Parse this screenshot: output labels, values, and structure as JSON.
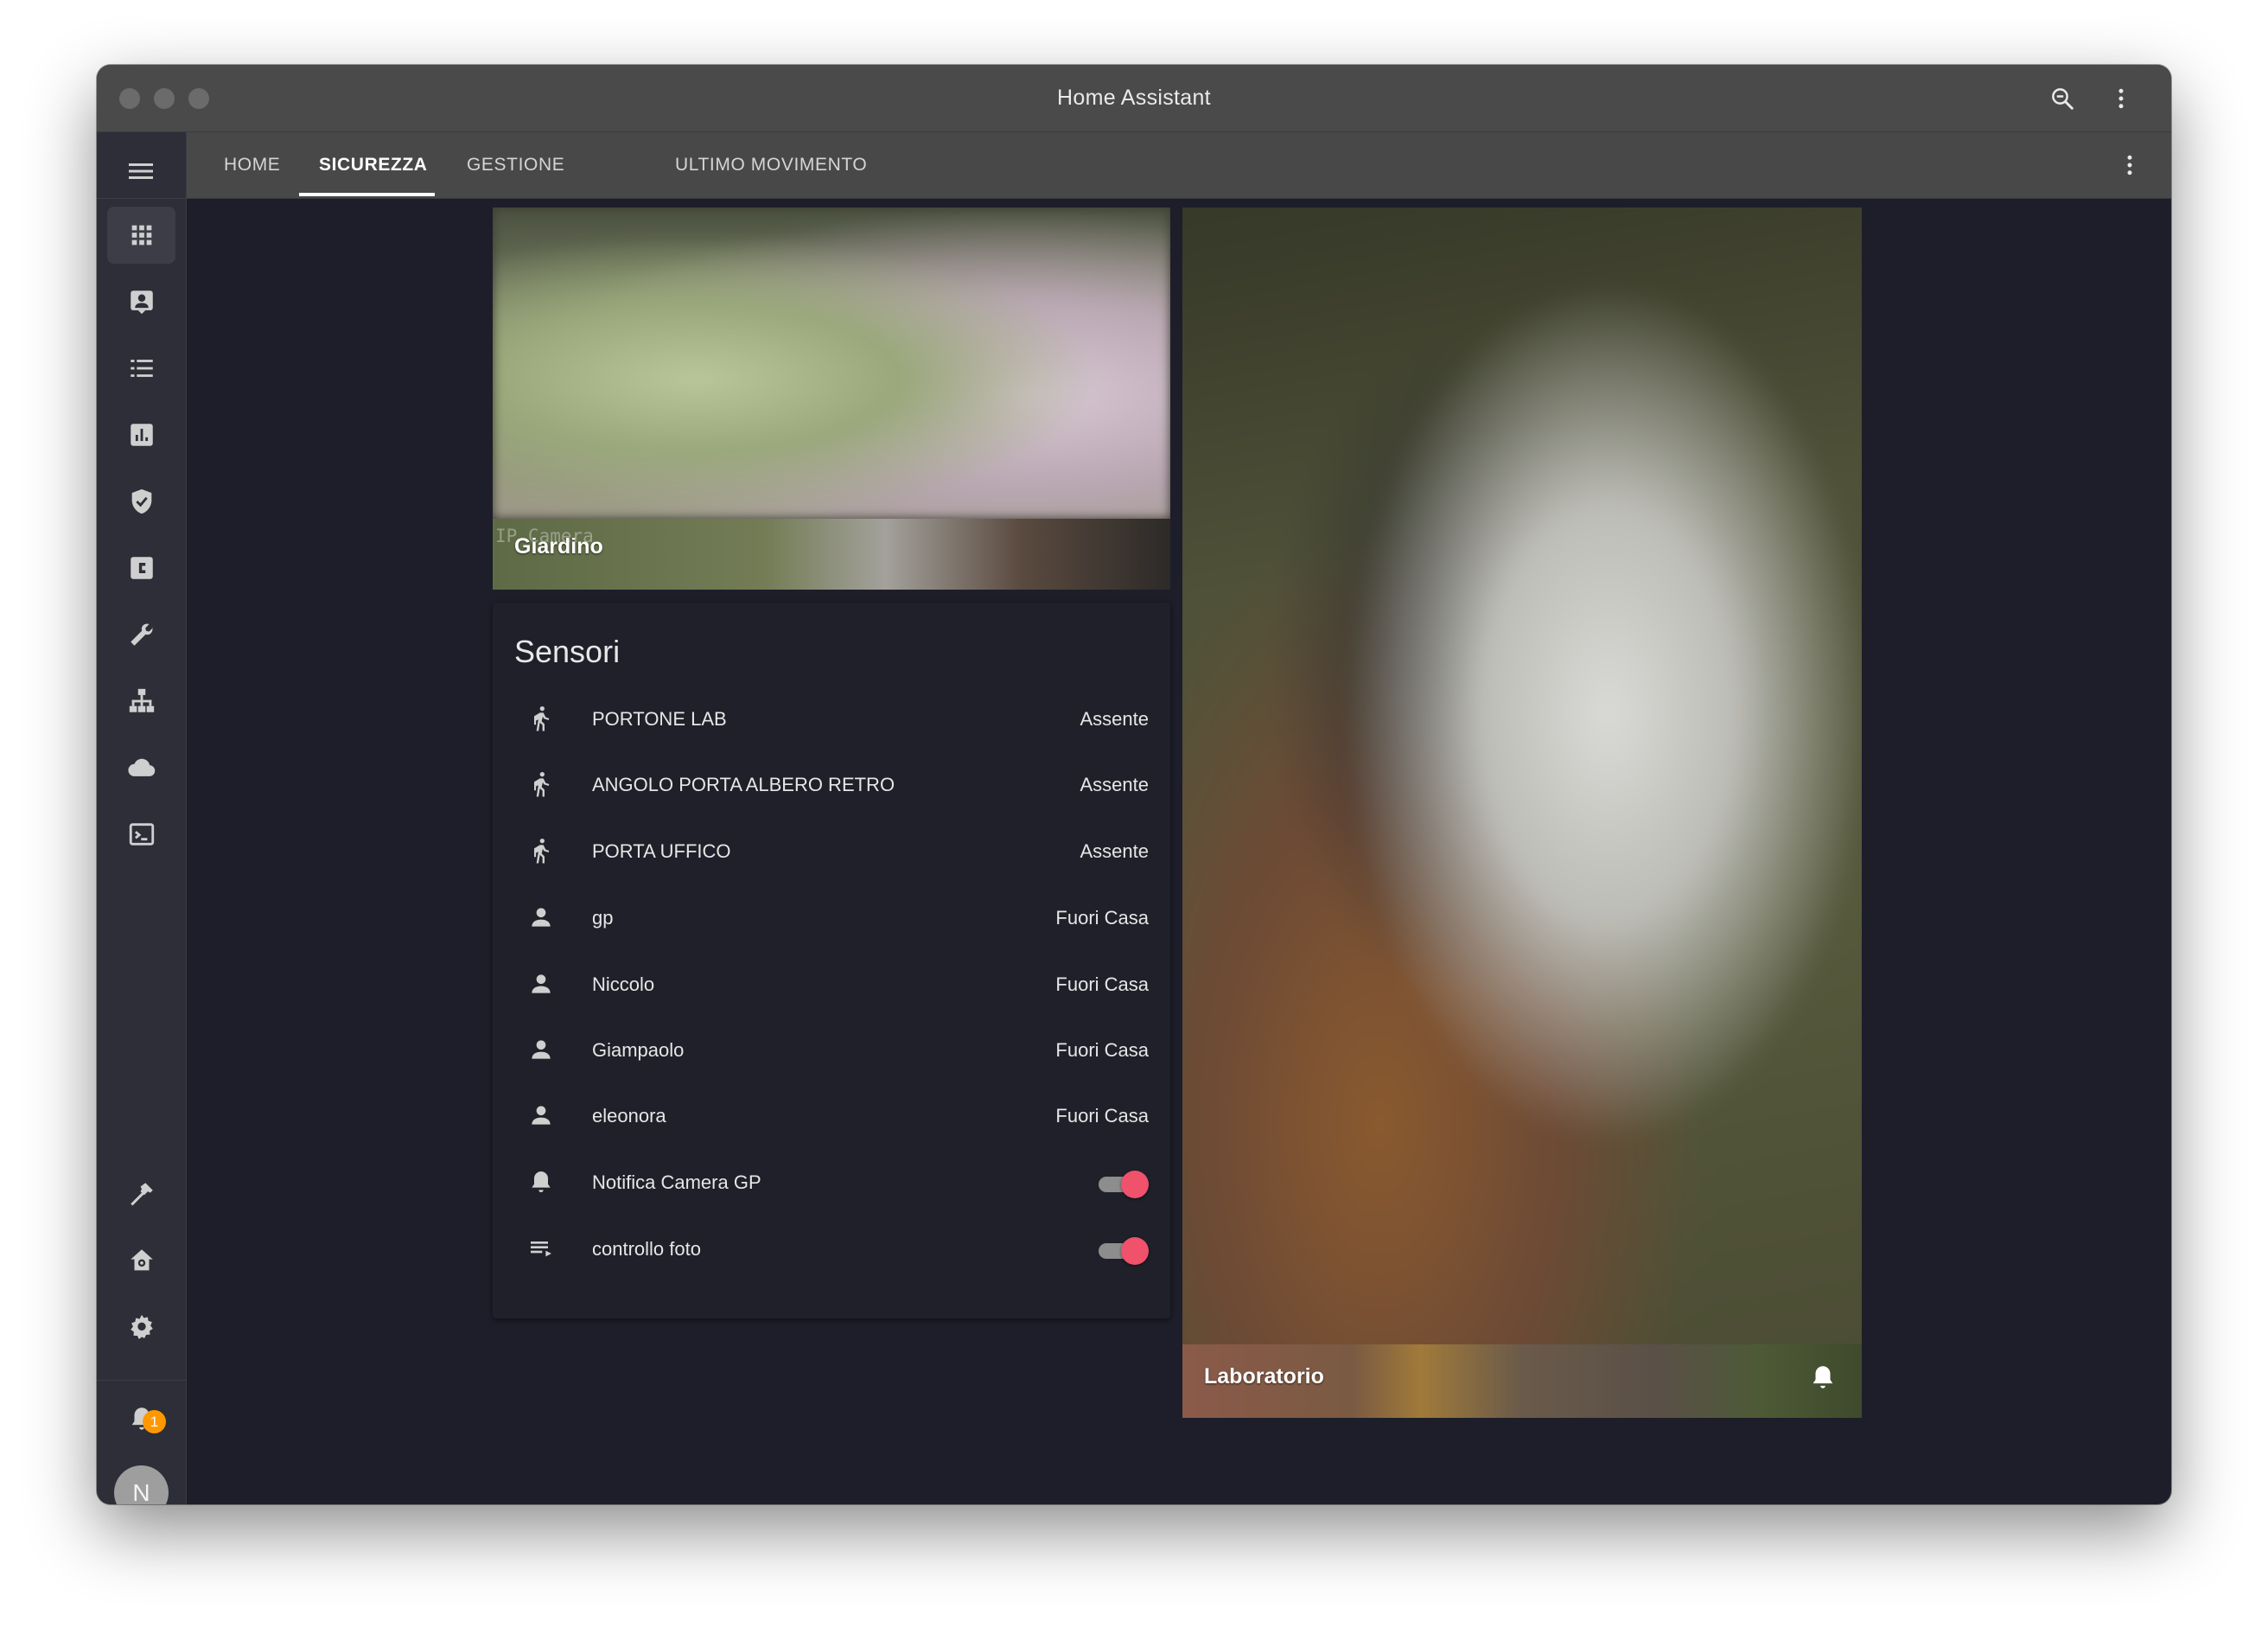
{
  "window": {
    "title": "Home Assistant"
  },
  "topnav": {
    "tabs": [
      {
        "label": "HOME"
      },
      {
        "label": "SICUREZZA"
      },
      {
        "label": "GESTIONE"
      },
      {
        "label": "ULTIMO MOVIMENTO"
      }
    ],
    "active_tab": "SICUREZZA"
  },
  "sidebar": {
    "items": [
      {
        "icon": "dashboard-grid-icon"
      },
      {
        "icon": "account-box-icon"
      },
      {
        "icon": "list-icon"
      },
      {
        "icon": "chart-box-icon"
      },
      {
        "icon": "shield-check-icon"
      },
      {
        "icon": "letter-c-box-icon"
      },
      {
        "icon": "wrench-icon"
      },
      {
        "icon": "sitemap-icon"
      },
      {
        "icon": "cloud-icon"
      },
      {
        "icon": "console-icon"
      }
    ],
    "bottom_items": [
      {
        "icon": "hammer-icon"
      },
      {
        "icon": "home-gear-icon"
      },
      {
        "icon": "settings-gear-icon"
      }
    ],
    "notification_count": "1",
    "user_initial": "N"
  },
  "cameras": {
    "giardino": {
      "overlay_text": "IP Camera",
      "label": "Giardino"
    },
    "laboratorio": {
      "label": "Laboratorio"
    }
  },
  "sensors_card": {
    "title": "Sensori",
    "rows": [
      {
        "icon": "walk-icon",
        "name": "PORTONE LAB",
        "state": "Assente"
      },
      {
        "icon": "walk-icon",
        "name": "ANGOLO PORTA ALBERO RETRO",
        "state": "Assente"
      },
      {
        "icon": "walk-icon",
        "name": "PORTA UFFICO",
        "state": "Assente"
      },
      {
        "icon": "account-icon",
        "name": "gp",
        "state": "Fuori Casa"
      },
      {
        "icon": "account-icon",
        "name": "Niccolo",
        "state": "Fuori Casa"
      },
      {
        "icon": "account-icon",
        "name": "Giampaolo",
        "state": "Fuori Casa"
      },
      {
        "icon": "account-icon",
        "name": "eleonora",
        "state": "Fuori Casa"
      },
      {
        "icon": "bell-icon",
        "name": "Notifica Camera GP",
        "toggle": true
      },
      {
        "icon": "playlist-play-icon",
        "name": "controllo foto",
        "toggle": true
      }
    ]
  },
  "colors": {
    "accent_toggle": "#f0516b",
    "badge": "#ff9800",
    "background": "#1d1e29",
    "header": "#484848"
  }
}
